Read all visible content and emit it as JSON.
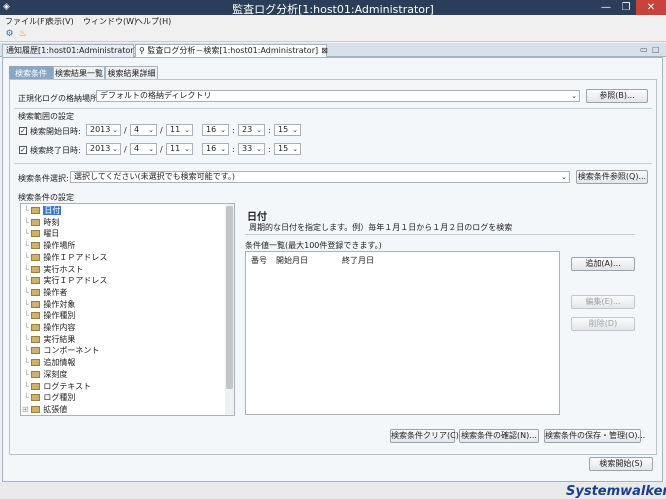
{
  "window": {
    "title": "監査ログ分析[1:host01:Administrator]",
    "minimize": "—",
    "maximize": "❐",
    "close": "✕"
  },
  "menu": [
    "ファイル(F)",
    "表示(V)",
    "ウィンドウ(W)",
    "ヘルプ(H)"
  ],
  "editor_tabs": [
    {
      "label": "通知履歴[1:host01:Administrator]",
      "active": false
    },
    {
      "label": "監査ログ分析－検索[1:host01:Administrator]",
      "active": true
    }
  ],
  "sub_tabs": [
    "検索条件",
    "検索結果一覧",
    "検索結果詳細"
  ],
  "storage": {
    "label": "正規化ログの格納場所:",
    "value": "デフォルトの格納ディレクトリ",
    "browse": "参照(B)..."
  },
  "range": {
    "section": "検索範囲の設定",
    "start": {
      "label": "検索開始日時:",
      "checked": true,
      "year": "2013",
      "month": "4",
      "day": "11",
      "hour": "16",
      "minute": "23",
      "second": "15"
    },
    "end": {
      "label": "検索終了日時:",
      "checked": true,
      "year": "2013",
      "month": "4",
      "day": "11",
      "hour": "16",
      "minute": "33",
      "second": "15"
    },
    "sep_slash": "/",
    "sep_colon": ":"
  },
  "condition_select": {
    "label": "検索条件選択:",
    "value": "選択してください(未選択でも検索可能です。)",
    "browse": "検索条件参照(Q)..."
  },
  "condition_section": "検索条件の設定",
  "tree_items": [
    "日付",
    "時刻",
    "曜日",
    "操作場所",
    "操作ＩＰアドレス",
    "実行ホスト",
    "実行ＩＰアドレス",
    "操作者",
    "操作対象",
    "操作種別",
    "操作内容",
    "実行結果",
    "コンポーネント",
    "追加情報",
    "深刻度",
    "ログテキスト",
    "ログ種別",
    "拡張値"
  ],
  "detail": {
    "title": "日付",
    "desc": "周期的な日付を指定します。例）毎年１月１日から１月２日のログを検索",
    "list_label": "条件値一覧(最大100件登録できます。)",
    "columns": [
      "番号",
      "開始月日",
      "終了月日"
    ],
    "add": "追加(A)...",
    "edit": "編集(E)...",
    "delete": "削除(D)"
  },
  "bottom_buttons": [
    "検索条件クリア(C)",
    "検索条件の確認(N)...",
    "検索条件の保存・管理(O)..."
  ],
  "start_search": "検索開始(S)",
  "logo": "Systemwalker",
  "colors": {
    "titlebar": "#2a3d59",
    "close": "#c7433b",
    "active_subtab": "#8aa6c4",
    "tree_selected": "#3b78d8"
  }
}
